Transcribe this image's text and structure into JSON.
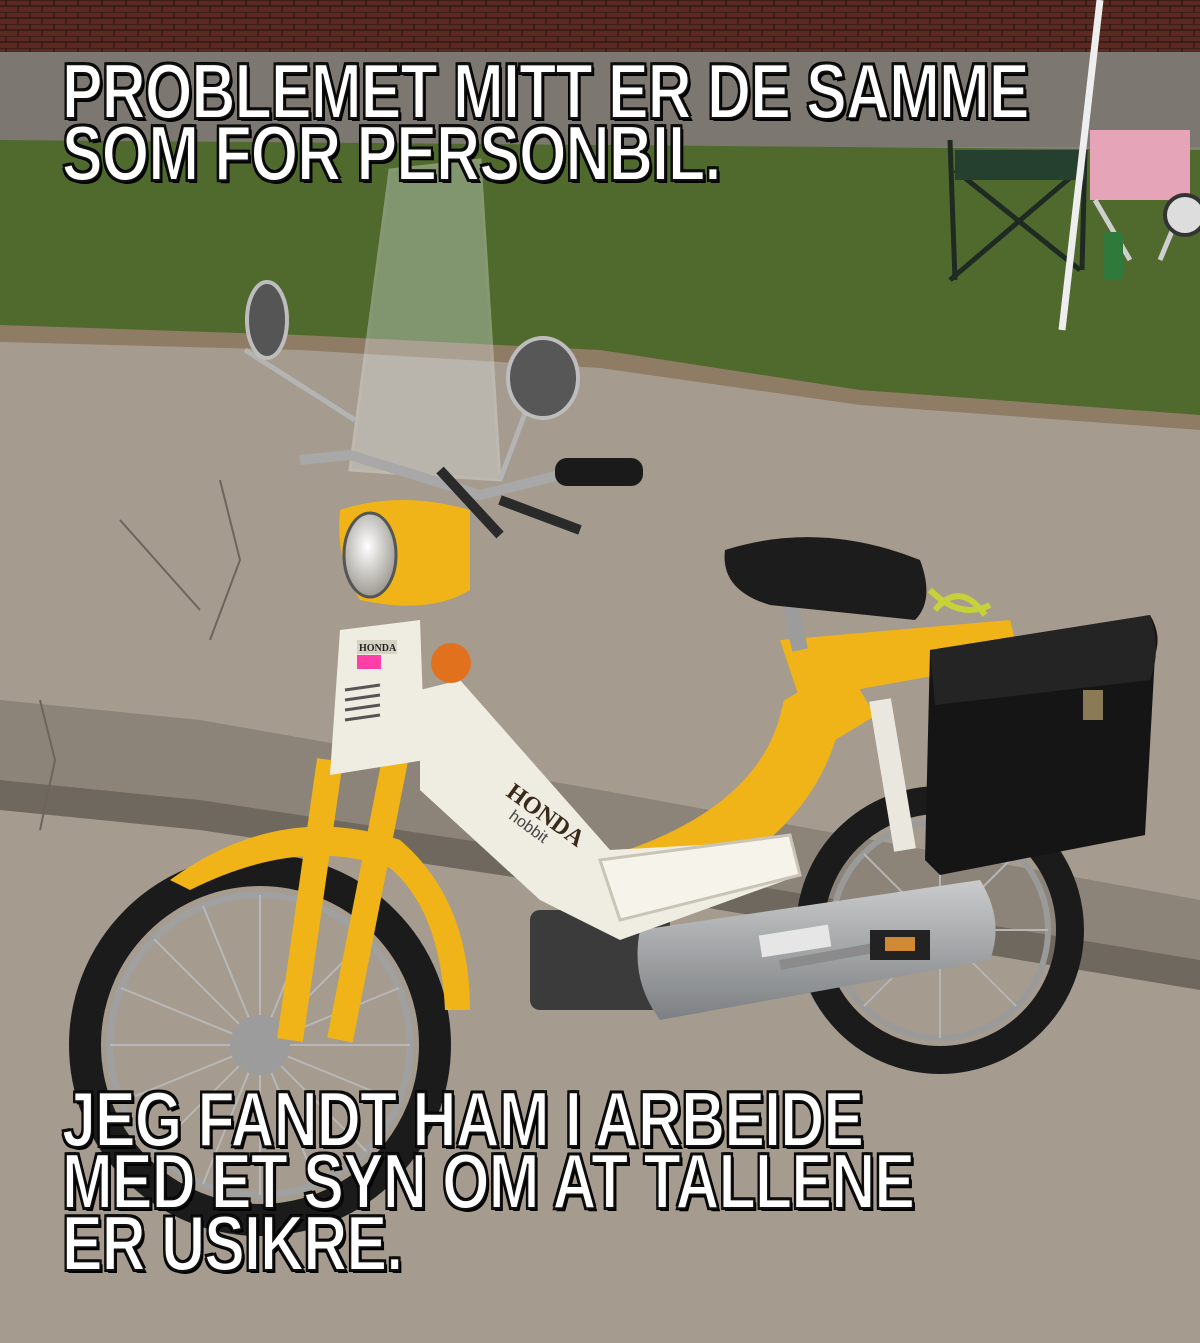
{
  "meme": {
    "top_lines": [
      "PROBLEMET MITT ER DE SAMME",
      "SOM FOR PERSONBIL."
    ],
    "bottom_lines": [
      "JEG FANDT HAM I ARBEIDE",
      "MED ET SYN OM AT TALLENE",
      "ER USIKRE."
    ]
  },
  "scene": {
    "subject": "yellow-white-moped",
    "badge_text": "HONDA",
    "tank_logo_text": "HONDA",
    "model_text": "hobbit",
    "colors": {
      "brick_wall": "#5a2a22",
      "grass": "#4f6a2c",
      "pavement": "#a59b8e",
      "moped_yellow": "#f0b418",
      "moped_white": "#efece2",
      "seat_black": "#1c1c1c",
      "caption_text": "#ffffff"
    }
  }
}
